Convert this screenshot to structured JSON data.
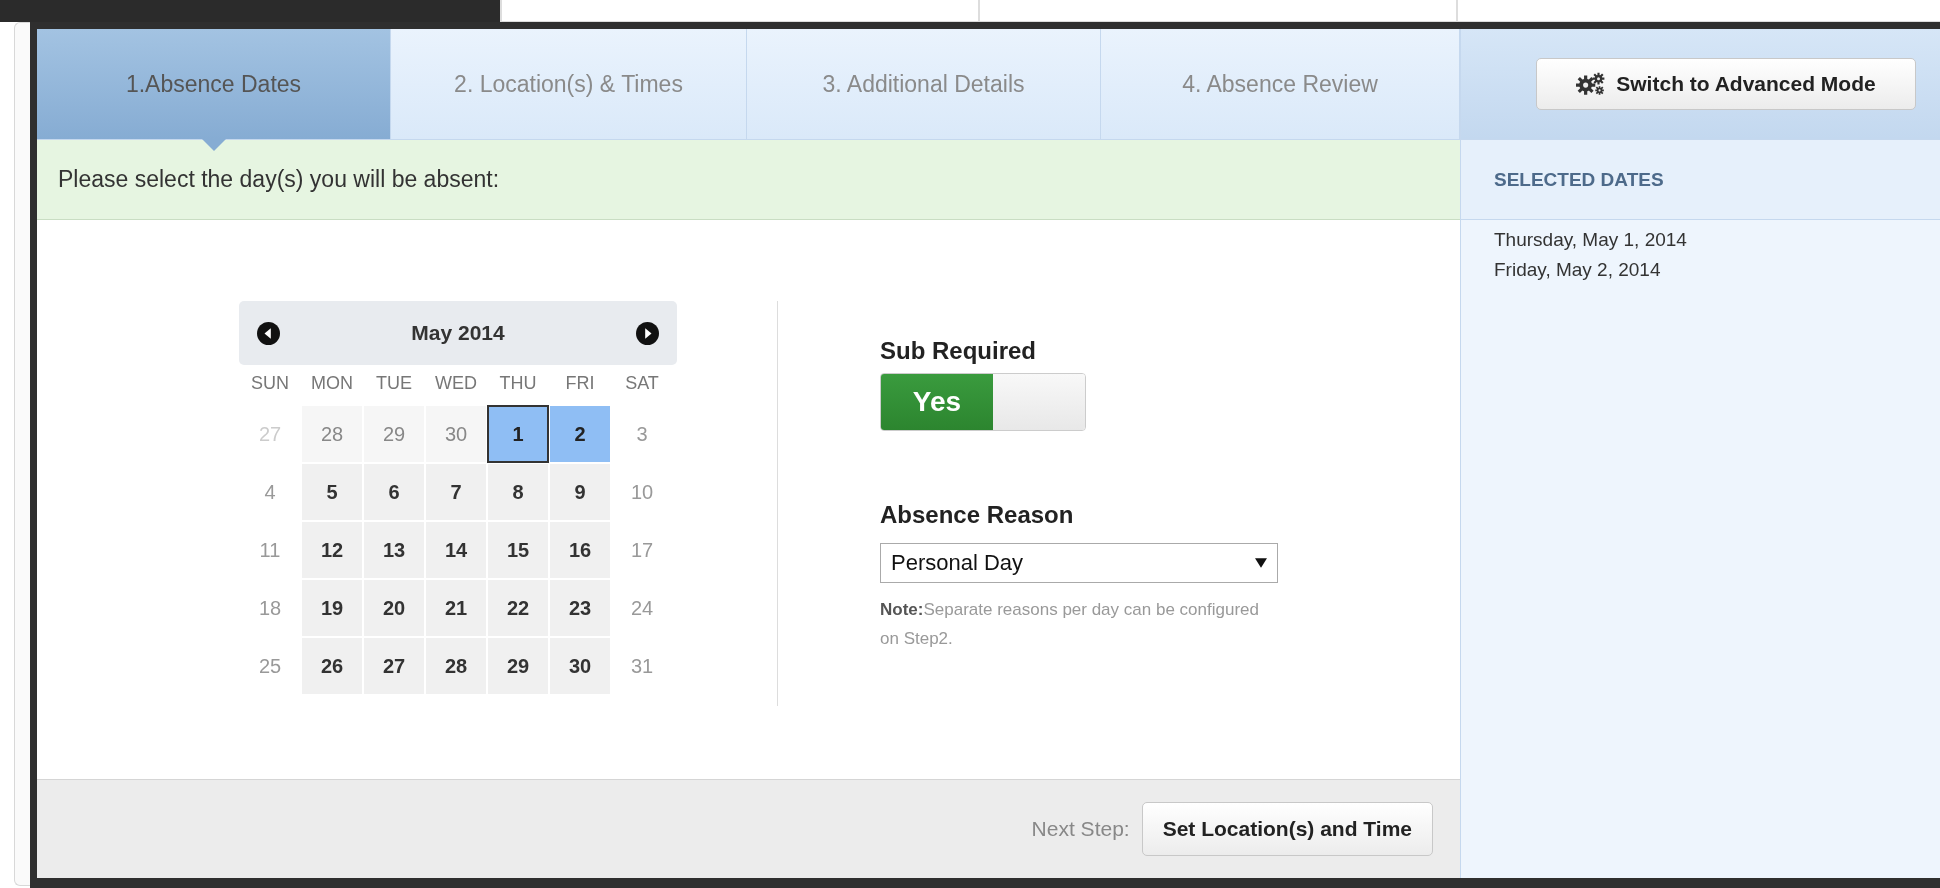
{
  "steps": [
    {
      "label": "1.Absence Dates",
      "selected": true
    },
    {
      "label": "2. Location(s) & Times",
      "selected": false
    },
    {
      "label": "3. Additional Details",
      "selected": false
    },
    {
      "label": "4. Absence Review",
      "selected": false
    }
  ],
  "instruction": "Please select the day(s) you will be absent:",
  "calendar": {
    "month": "May 2014",
    "weekdays": [
      "SUN",
      "MON",
      "TUE",
      "WED",
      "THU",
      "FRI",
      "SAT"
    ],
    "weeks": [
      [
        {
          "day": "27",
          "kind": "outside-weekend",
          "selected": false,
          "focused": false
        },
        {
          "day": "28",
          "kind": "outside",
          "selected": false,
          "focused": false
        },
        {
          "day": "29",
          "kind": "outside",
          "selected": false,
          "focused": false
        },
        {
          "day": "30",
          "kind": "outside",
          "selected": false,
          "focused": false
        },
        {
          "day": "1",
          "kind": "weekday",
          "selected": true,
          "focused": true
        },
        {
          "day": "2",
          "kind": "weekday",
          "selected": true,
          "focused": false
        },
        {
          "day": "3",
          "kind": "weekend",
          "selected": false,
          "focused": false
        }
      ],
      [
        {
          "day": "4",
          "kind": "weekend",
          "selected": false,
          "focused": false
        },
        {
          "day": "5",
          "kind": "weekday",
          "selected": false,
          "focused": false
        },
        {
          "day": "6",
          "kind": "weekday",
          "selected": false,
          "focused": false
        },
        {
          "day": "7",
          "kind": "weekday",
          "selected": false,
          "focused": false
        },
        {
          "day": "8",
          "kind": "weekday",
          "selected": false,
          "focused": false
        },
        {
          "day": "9",
          "kind": "weekday",
          "selected": false,
          "focused": false
        },
        {
          "day": "10",
          "kind": "weekend",
          "selected": false,
          "focused": false
        }
      ],
      [
        {
          "day": "11",
          "kind": "weekend",
          "selected": false,
          "focused": false
        },
        {
          "day": "12",
          "kind": "weekday",
          "selected": false,
          "focused": false
        },
        {
          "day": "13",
          "kind": "weekday",
          "selected": false,
          "focused": false
        },
        {
          "day": "14",
          "kind": "weekday",
          "selected": false,
          "focused": false
        },
        {
          "day": "15",
          "kind": "weekday",
          "selected": false,
          "focused": false
        },
        {
          "day": "16",
          "kind": "weekday",
          "selected": false,
          "focused": false
        },
        {
          "day": "17",
          "kind": "weekend",
          "selected": false,
          "focused": false
        }
      ],
      [
        {
          "day": "18",
          "kind": "weekend",
          "selected": false,
          "focused": false
        },
        {
          "day": "19",
          "kind": "weekday",
          "selected": false,
          "focused": false
        },
        {
          "day": "20",
          "kind": "weekday",
          "selected": false,
          "focused": false
        },
        {
          "day": "21",
          "kind": "weekday",
          "selected": false,
          "focused": false
        },
        {
          "day": "22",
          "kind": "weekday",
          "selected": false,
          "focused": false
        },
        {
          "day": "23",
          "kind": "weekday",
          "selected": false,
          "focused": false
        },
        {
          "day": "24",
          "kind": "weekend",
          "selected": false,
          "focused": false
        }
      ],
      [
        {
          "day": "25",
          "kind": "weekend",
          "selected": false,
          "focused": false
        },
        {
          "day": "26",
          "kind": "weekday",
          "selected": false,
          "focused": false
        },
        {
          "day": "27",
          "kind": "weekday",
          "selected": false,
          "focused": false
        },
        {
          "day": "28",
          "kind": "weekday",
          "selected": false,
          "focused": false
        },
        {
          "day": "29",
          "kind": "weekday",
          "selected": false,
          "focused": false
        },
        {
          "day": "30",
          "kind": "weekday",
          "selected": false,
          "focused": false
        },
        {
          "day": "31",
          "kind": "weekend",
          "selected": false,
          "focused": false
        }
      ]
    ]
  },
  "sub_required": {
    "label": "Sub Required",
    "on": true,
    "on_text": "Yes"
  },
  "absence_reason": {
    "label": "Absence Reason",
    "value": "Personal Day",
    "note": "**Note:**Separate reasons per day can be configured on Step2."
  },
  "footer": {
    "next_label": "Next Step:",
    "button": "Set Location(s) and Time"
  },
  "side_panel": {
    "button": "Switch to Advanced Mode",
    "heading": "SELECTED DATES",
    "dates": [
      "Thursday, May 1, 2014",
      "Friday, May 2, 2014"
    ]
  }
}
